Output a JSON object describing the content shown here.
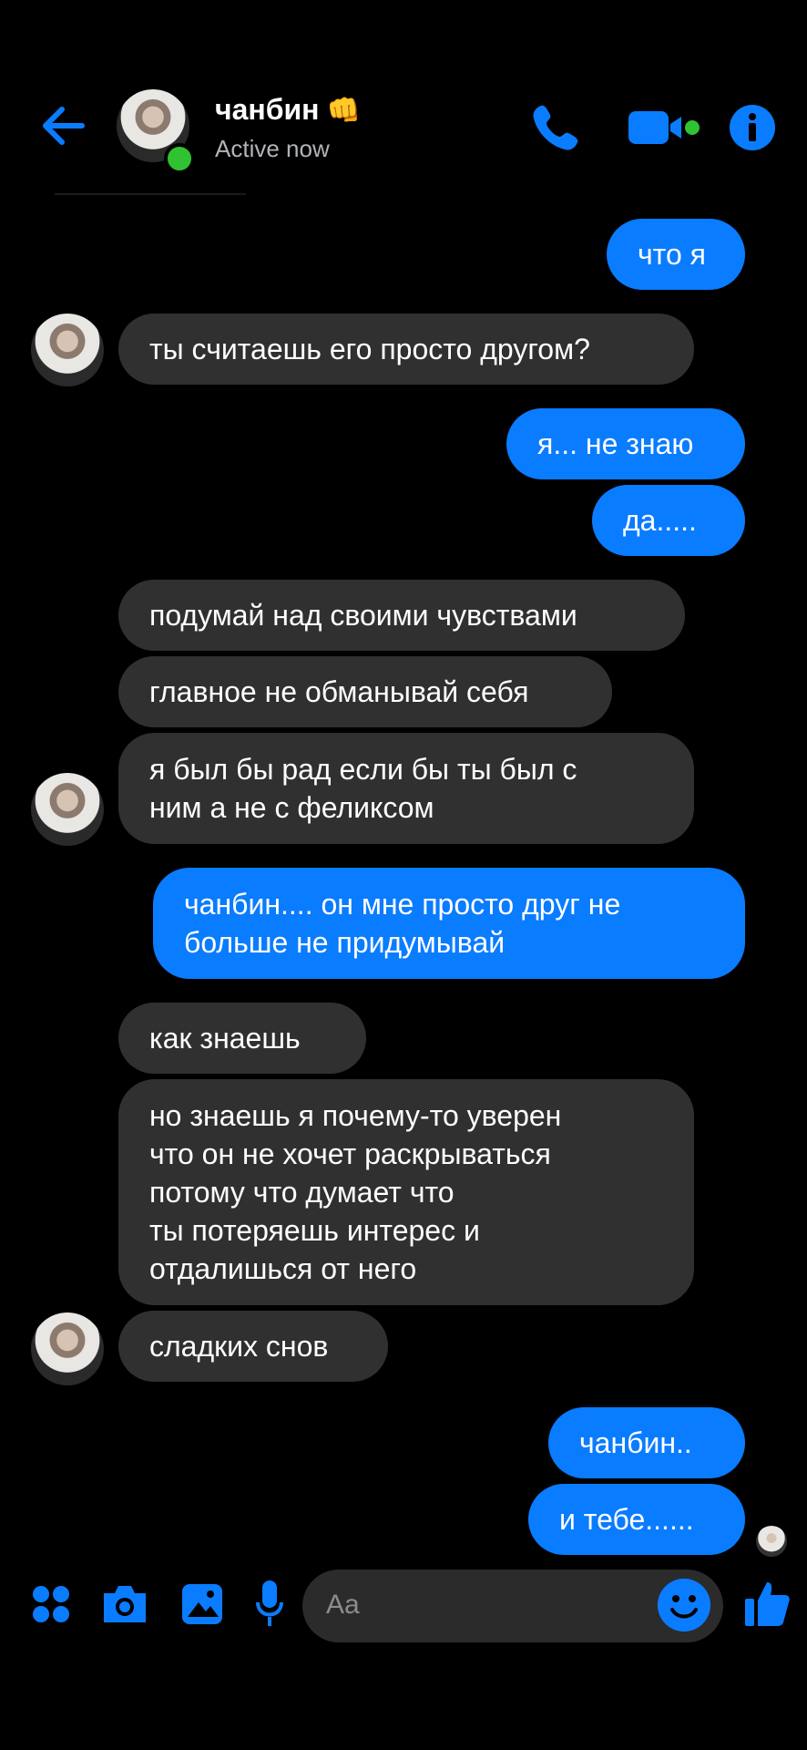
{
  "header": {
    "contact_name": "чанбин",
    "name_emoji": "👊",
    "status": "Active now"
  },
  "messages": [
    {
      "from": "me",
      "text": "что я"
    },
    {
      "from": "them",
      "text": "ты считаешь его просто другом?"
    },
    {
      "from": "me",
      "text": "я... не знаю"
    },
    {
      "from": "me",
      "text": "да....."
    },
    {
      "from": "them",
      "text": "подумай над своими чувствами"
    },
    {
      "from": "them",
      "text": "главное не обманывай себя"
    },
    {
      "from": "them",
      "text": "я был бы рад если бы ты был с\nним а не с феликсом"
    },
    {
      "from": "me",
      "text": "чанбин.... он мне просто друг не\nбольше не придумывай"
    },
    {
      "from": "them",
      "text": "как знаешь"
    },
    {
      "from": "them",
      "text": "но знаешь я почему-то уверен\nчто он не хочет раскрываться\nпотому что думает что\nты потеряешь интерес и\nотдалишься от него"
    },
    {
      "from": "them",
      "text": "сладких снов"
    },
    {
      "from": "me",
      "text": "чанбин.."
    },
    {
      "from": "me",
      "text": "и тебе......"
    }
  ],
  "composer": {
    "placeholder": "Aa"
  },
  "colors": {
    "accent": "#0a7cff",
    "incoming_bubble": "#303030",
    "online": "#31c231"
  }
}
